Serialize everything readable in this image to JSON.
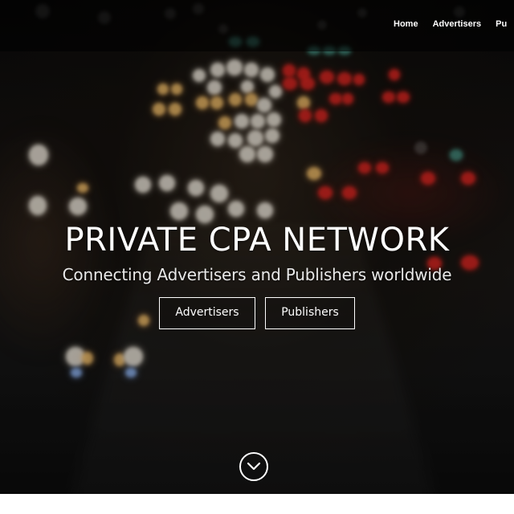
{
  "nav": {
    "items": [
      {
        "label": "Home"
      },
      {
        "label": "Advertisers"
      },
      {
        "label": "Pu"
      }
    ]
  },
  "hero": {
    "title": "PRIVATE CPA NETWORK",
    "subtitle": "Connecting Advertisers and Publishers worldwide",
    "buttons": {
      "advertisers_label": "Advertisers",
      "publishers_label": "Publishers"
    },
    "scroll_icon": "chevron-down-circle-icon"
  },
  "colors": {
    "text": "#ffffff",
    "background": "#0a0a0a"
  }
}
